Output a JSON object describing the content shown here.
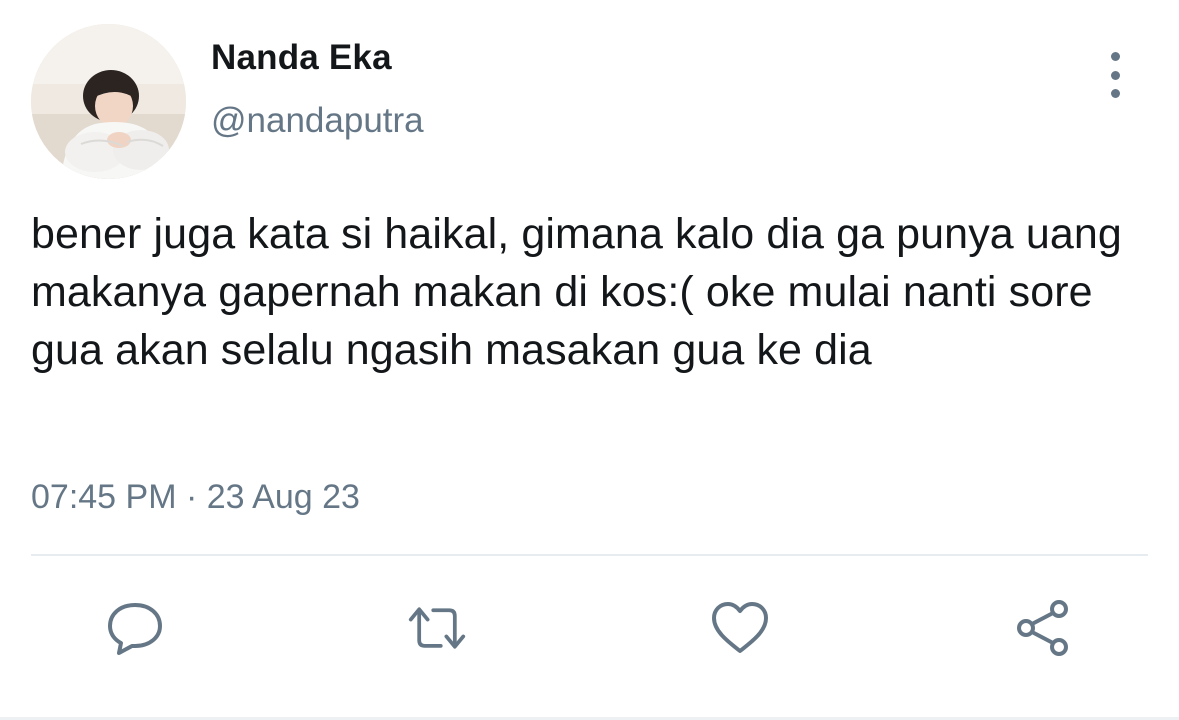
{
  "user": {
    "display_name": "Nanda Eka",
    "handle": "@nandaputra"
  },
  "tweet": {
    "text": "bener juga kata si haikal, gimana kalo dia ga punya uang makanya gapernah makan di kos:( oke mulai nanti sore gua akan selalu ngasih masakan gua ke dia",
    "time": "07:45 PM",
    "separator": " · ",
    "date": "23 Aug 23"
  },
  "actions": [
    {
      "name": "reply",
      "icon": "speech-bubble-icon"
    },
    {
      "name": "retweet",
      "icon": "retweet-icon"
    },
    {
      "name": "like",
      "icon": "heart-icon"
    },
    {
      "name": "share",
      "icon": "share-icon"
    }
  ],
  "colors": {
    "text": "#14171a",
    "secondary": "#657786",
    "divider": "#e6ecf0",
    "background": "#ffffff"
  }
}
